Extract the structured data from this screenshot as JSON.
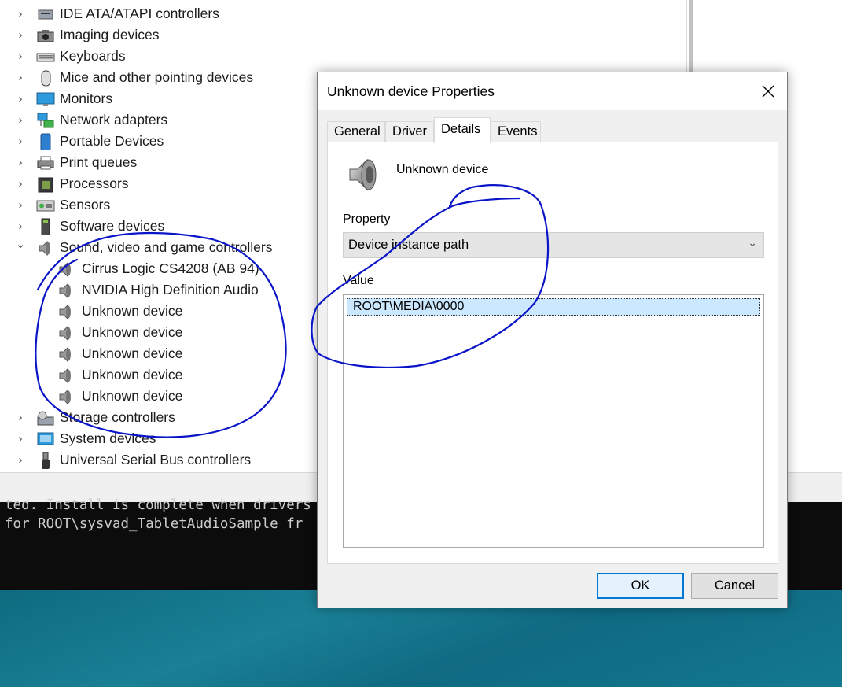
{
  "device_manager": {
    "categories": [
      {
        "label": "IDE ATA/ATAPI controllers",
        "icon": "ide-controller-icon",
        "expanded": false
      },
      {
        "label": "Imaging devices",
        "icon": "camera-icon",
        "expanded": false
      },
      {
        "label": "Keyboards",
        "icon": "keyboard-icon",
        "expanded": false
      },
      {
        "label": "Mice and other pointing devices",
        "icon": "mouse-icon",
        "expanded": false
      },
      {
        "label": "Monitors",
        "icon": "monitor-icon",
        "expanded": false
      },
      {
        "label": "Network adapters",
        "icon": "network-icon",
        "expanded": false
      },
      {
        "label": "Portable Devices",
        "icon": "portable-device-icon",
        "expanded": false
      },
      {
        "label": "Print queues",
        "icon": "printer-icon",
        "expanded": false
      },
      {
        "label": "Processors",
        "icon": "processor-icon",
        "expanded": false
      },
      {
        "label": "Sensors",
        "icon": "sensor-icon",
        "expanded": false
      },
      {
        "label": "Software devices",
        "icon": "software-device-icon",
        "expanded": false
      },
      {
        "label": "Sound, video and game controllers",
        "icon": "speaker-icon",
        "expanded": true
      },
      {
        "label": "Storage controllers",
        "icon": "storage-icon",
        "expanded": false
      },
      {
        "label": "System devices",
        "icon": "system-icon",
        "expanded": false
      },
      {
        "label": "Universal Serial Bus controllers",
        "icon": "usb-icon",
        "expanded": false
      }
    ],
    "sound_children": [
      {
        "label": "Cirrus Logic CS4208 (AB 94)"
      },
      {
        "label": "NVIDIA High Definition Audio"
      },
      {
        "label": "Unknown device"
      },
      {
        "label": "Unknown device"
      },
      {
        "label": "Unknown device"
      },
      {
        "label": "Unknown device"
      },
      {
        "label": "Unknown device"
      }
    ]
  },
  "console": {
    "line1": "ted. Install is complete when drivers",
    "line2": " for ROOT\\sysvad_TabletAudioSample fr"
  },
  "dialog": {
    "title": "Unknown device Properties",
    "tabs": [
      {
        "label": "General"
      },
      {
        "label": "Driver"
      },
      {
        "label": "Details"
      },
      {
        "label": "Events"
      }
    ],
    "active_tab": "Details",
    "device_name": "Unknown device",
    "property_label": "Property",
    "property_value": "Device instance path",
    "value_label": "Value",
    "value": "ROOT\\MEDIA\\0000",
    "ok_label": "OK",
    "cancel_label": "Cancel"
  },
  "colors": {
    "annotation_ink": "#0a14c8",
    "selection": "#cce8ff",
    "accent": "#0078d7",
    "desktop": "#137991"
  }
}
